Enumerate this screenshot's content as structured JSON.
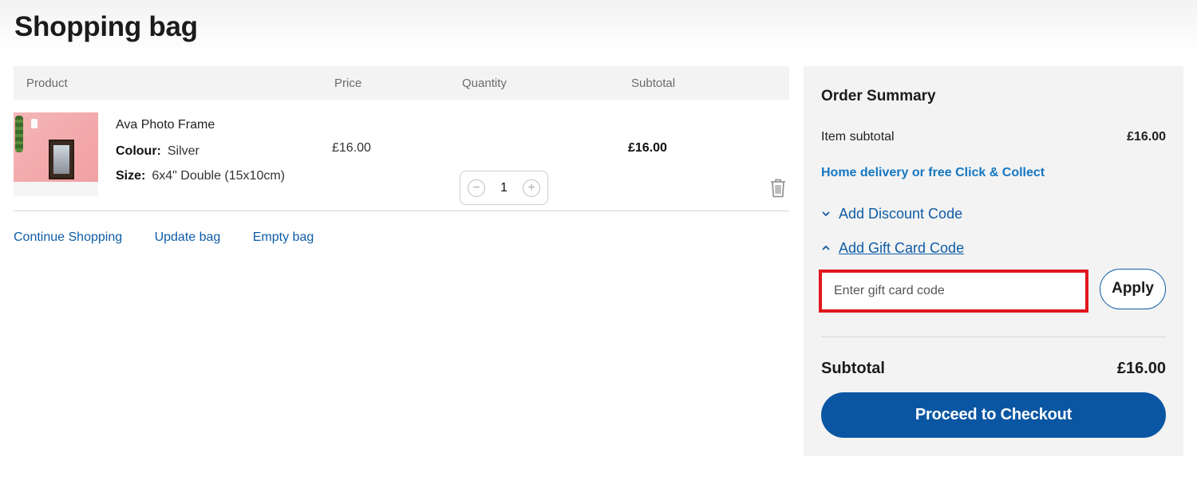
{
  "page": {
    "title": "Shopping bag"
  },
  "cart": {
    "headers": {
      "product": "Product",
      "price": "Price",
      "quantity": "Quantity",
      "subtotal": "Subtotal"
    },
    "item": {
      "name": "Ava Photo Frame",
      "colour_label": "Colour:",
      "colour_value": "Silver",
      "size_label": "Size:",
      "size_value": "6x4\" Double (15x10cm)",
      "price": "£16.00",
      "quantity": "1",
      "subtotal": "£16.00",
      "qty_minus": "−",
      "qty_plus": "+"
    },
    "links": {
      "continue": "Continue Shopping",
      "update": "Update bag",
      "empty": "Empty bag"
    }
  },
  "summary": {
    "title": "Order Summary",
    "item_subtotal_label": "Item subtotal",
    "item_subtotal_value": "£16.00",
    "delivery_link": "Home delivery or free Click & Collect",
    "discount_toggle": "Add Discount Code",
    "gift_toggle": "Add Gift Card Code",
    "gift_placeholder": "Enter gift card code",
    "gift_value": "",
    "apply_label": "Apply",
    "subtotal_label": "Subtotal",
    "subtotal_value": "£16.00",
    "checkout_label": "Proceed to Checkout"
  },
  "icons": {
    "trash": "trash-icon",
    "chevron_down": "chevron-down-icon",
    "chevron_up": "chevron-up-icon"
  },
  "colors": {
    "link": "#0f5ca6",
    "primary": "#0a56a3",
    "highlight": "#e0161d"
  }
}
